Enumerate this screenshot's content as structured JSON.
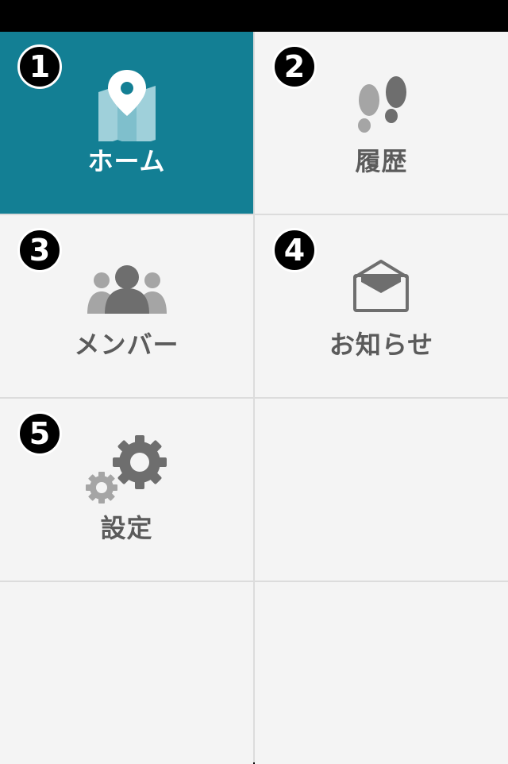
{
  "menu": {
    "items": [
      {
        "number": "1",
        "label": "ホーム",
        "icon": "map-pin-icon",
        "active": true
      },
      {
        "number": "2",
        "label": "履歴",
        "icon": "footprints-icon",
        "active": false
      },
      {
        "number": "3",
        "label": "メンバー",
        "icon": "members-icon",
        "active": false
      },
      {
        "number": "4",
        "label": "お知らせ",
        "icon": "envelope-open-icon",
        "active": false
      },
      {
        "number": "5",
        "label": "設定",
        "icon": "gear-icon",
        "active": false
      }
    ]
  },
  "colors": {
    "active_tile": "#137f94",
    "tile": "#f4f4f4",
    "divider": "#dcdcdc",
    "icon_gray": "#6e6e6e",
    "icon_light_gray": "#a5a5a5",
    "label_gray": "#5b5b5b"
  }
}
